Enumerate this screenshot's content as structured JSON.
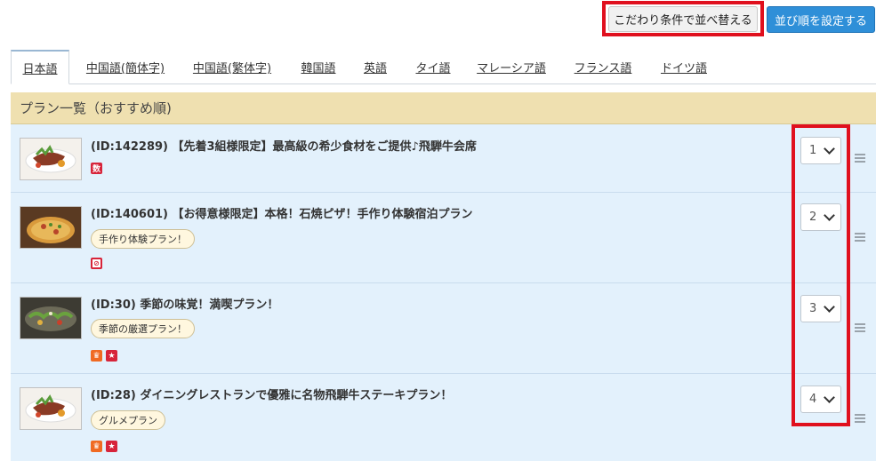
{
  "top": {
    "sort_by_conditions": "こだわり条件で並べ替える",
    "set_order": "並び順を設定する"
  },
  "tabs": [
    "日本語",
    "中国語(簡体字)",
    "中国語(繁体字)",
    "韓国語",
    "英語",
    "タイ語",
    "マレーシア語",
    "フランス語",
    "ドイツ語"
  ],
  "list_header": "プラン一覧（おすすめ順)",
  "plans": [
    {
      "title": "(ID:142289) 【先着3組様限定】最高級の希少食材をご提供♪飛騨牛会席",
      "tag": "",
      "badges": [
        "数"
      ],
      "order": "1"
    },
    {
      "title": "(ID:140601) 【お得意様限定】本格！石焼ピザ！手作り体験宿泊プラン",
      "tag": "手作り体験プラン！",
      "badges": [
        "⊘"
      ],
      "order": "2"
    },
    {
      "title": "(ID:30) 季節の味覚！満喫プラン！",
      "tag": "季節の厳選プラン！",
      "badges": [
        "♛",
        "★"
      ],
      "order": "3"
    },
    {
      "title": "(ID:28) ダイニングレストランで優雅に名物飛騨牛ステーキプラン！",
      "tag": "グルメプラン",
      "badges": [
        "♛",
        "★"
      ],
      "order": "4"
    }
  ]
}
